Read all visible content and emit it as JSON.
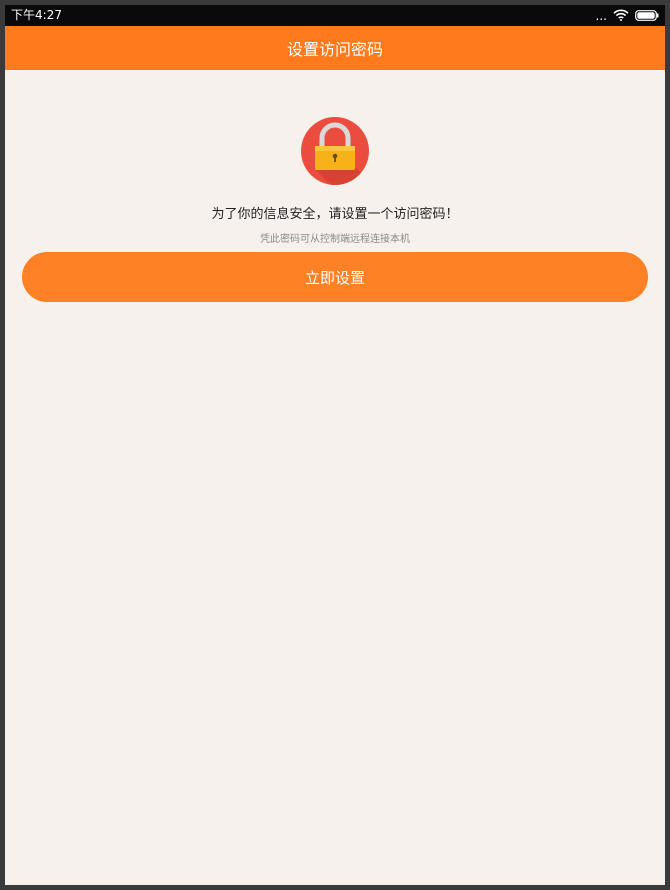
{
  "status_bar": {
    "time": "下午4:27",
    "icons": [
      "more-dots-icon",
      "wifi-icon",
      "battery-icon"
    ],
    "more_dots": "..."
  },
  "app_bar": {
    "title": "设置访问密码"
  },
  "main": {
    "icon": "lock-icon",
    "headline": "为了你的信息安全，请设置一个访问密码！",
    "subline": "凭此密码可从控制端远程连接本机",
    "button_label": "立即设置"
  },
  "colors": {
    "accent": "#ff7a1c",
    "button": "#ff8126",
    "background": "#f6f1ed",
    "lock_circle": "#ea4d3d",
    "lock_body": "#f7b21a"
  }
}
